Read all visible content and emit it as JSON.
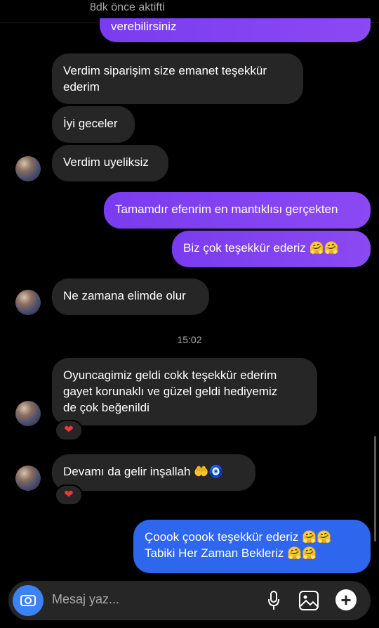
{
  "header": {
    "status": "8dk önce aktifti"
  },
  "messages": {
    "m0": "verebilirsiniz",
    "m1_l1": "Verdim siparişim size emanet teşekkür",
    "m1_l2": "ederim",
    "m2": "İyi geceler",
    "m3": "Verdim uyeliksiz",
    "m4": "Tamamdır efenrim en mantıklısı gerçekten",
    "m5": "Biz çok teşekkür ederiz 🤗🤗",
    "m6": "Ne zamana elimde olur",
    "time": "15:02",
    "m7_l1": "Oyuncagimiz geldi cokk teşekkür ederim",
    "m7_l2": "gayet korunaklı ve güzel geldi hediyemiz",
    "m7_l3": "de çok beğenildi",
    "m8": "Devamı da  gelir inşallah 🤲🧿",
    "m9_l1": "Çoook çoook teşekkür ederiz 🤗🤗",
    "m9_l2": "Tabiki Her Zaman Bekleriz 🤗🤗",
    "reaction": "❤"
  },
  "composer": {
    "placeholder": "Mesaj yaz..."
  },
  "icons": [
    "back-icon",
    "video-call-icon",
    "flag-icon",
    "info-icon",
    "camera-icon",
    "microphone-icon",
    "gallery-icon",
    "plus-icon",
    "heart-icon"
  ],
  "colors": {
    "background": "#000000",
    "incoming": "#262626",
    "outgoing": "#7a3cf0",
    "outgoing_blue": "#2f66ee",
    "camera": "#3b82f6"
  }
}
